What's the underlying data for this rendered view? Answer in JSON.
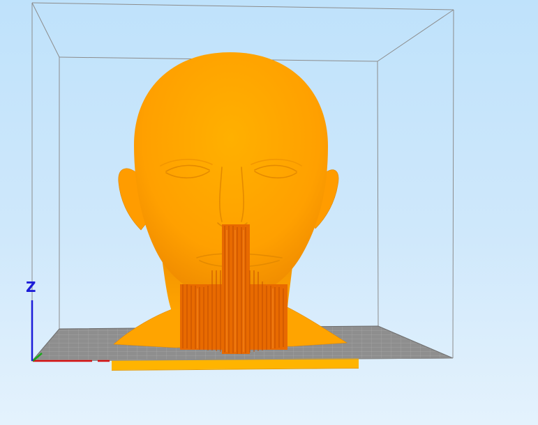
{
  "viewport": {
    "axis_z_label": "Z",
    "colors": {
      "background_top": "#bfe2fb",
      "background_bottom": "#e4f2fd",
      "model": "#ffa200",
      "supports": "#e86a00",
      "bed": "#8e8e8e",
      "bed_grid": "#b0b0b0",
      "raft": "#ffb400",
      "axis_x": "#d41010",
      "axis_y": "#18a818",
      "axis_z": "#1c1cd8",
      "build_volume_lines": "#8c8c8c"
    },
    "model": {
      "name": "head-bust"
    }
  }
}
